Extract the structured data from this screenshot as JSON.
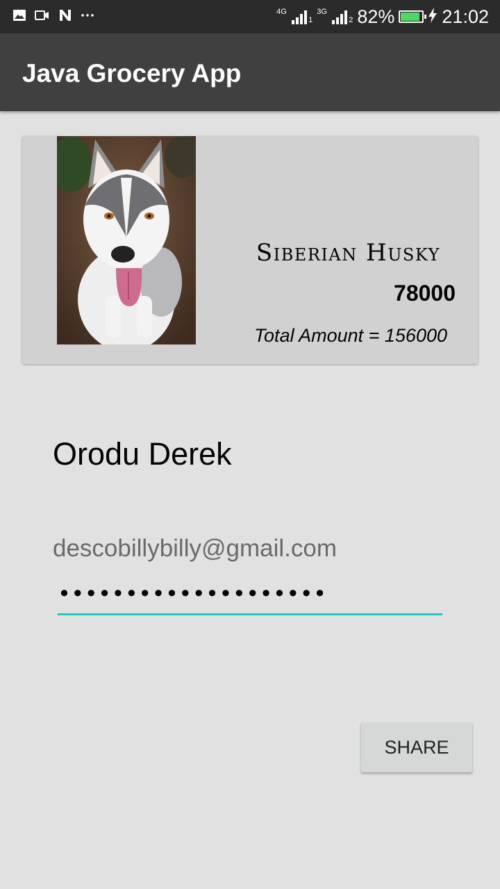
{
  "status_bar": {
    "net1_label": "4G",
    "net1_sim": "1",
    "net2_label": "3G",
    "net2_sim": "2",
    "battery_percent": "82%",
    "battery_level": 0.82,
    "time": "21:02",
    "icons": [
      "image-icon",
      "video-icon",
      "n-icon",
      "more-icon",
      "signal-icon",
      "battery-icon",
      "charging-icon"
    ]
  },
  "app_bar": {
    "title": "Java Grocery App"
  },
  "product_card": {
    "image_icon": "husky-photo",
    "name": "Siberian Husky",
    "price": "78000",
    "total": "Total Amount = 156000"
  },
  "form": {
    "name": "Orodu Derek",
    "email": "descobillybilly@gmail.com",
    "password_masked": "••••••••••••••••••••"
  },
  "actions": {
    "share_label": "SHARE"
  },
  "colors": {
    "status_bar": "#2b2b2b",
    "app_bar": "#404040",
    "background": "#e1e1e1",
    "card": "#d1d1d1",
    "accent": "#20c7c0",
    "battery": "#4cd964"
  }
}
